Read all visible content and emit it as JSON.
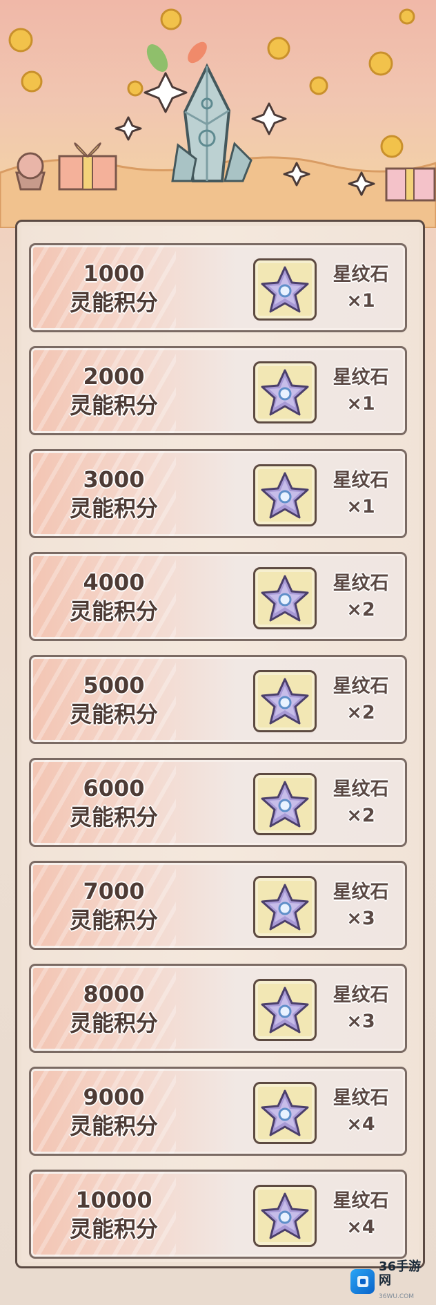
{
  "rows": [
    {
      "points": "1000",
      "points_label": "灵能积分",
      "reward_name": "星纹石",
      "reward_qty": "×1"
    },
    {
      "points": "2000",
      "points_label": "灵能积分",
      "reward_name": "星纹石",
      "reward_qty": "×1"
    },
    {
      "points": "3000",
      "points_label": "灵能积分",
      "reward_name": "星纹石",
      "reward_qty": "×1"
    },
    {
      "points": "4000",
      "points_label": "灵能积分",
      "reward_name": "星纹石",
      "reward_qty": "×2"
    },
    {
      "points": "5000",
      "points_label": "灵能积分",
      "reward_name": "星纹石",
      "reward_qty": "×2"
    },
    {
      "points": "6000",
      "points_label": "灵能积分",
      "reward_name": "星纹石",
      "reward_qty": "×2"
    },
    {
      "points": "7000",
      "points_label": "灵能积分",
      "reward_name": "星纹石",
      "reward_qty": "×3"
    },
    {
      "points": "8000",
      "points_label": "灵能积分",
      "reward_name": "星纹石",
      "reward_qty": "×3"
    },
    {
      "points": "9000",
      "points_label": "灵能积分",
      "reward_name": "星纹石",
      "reward_qty": "×4"
    },
    {
      "points": "10000",
      "points_label": "灵能积分",
      "reward_name": "星纹石",
      "reward_qty": "×4"
    }
  ],
  "watermark": {
    "logo_text": "36",
    "brand": "手游网",
    "url": "36WU.COM"
  },
  "icons": {
    "banner": "crystal-icon",
    "reward": "star-stone-icon"
  },
  "colors": {
    "panel_border": "#5b4a43",
    "text": "#4d3b35",
    "star_fill": "#a89ad6"
  }
}
